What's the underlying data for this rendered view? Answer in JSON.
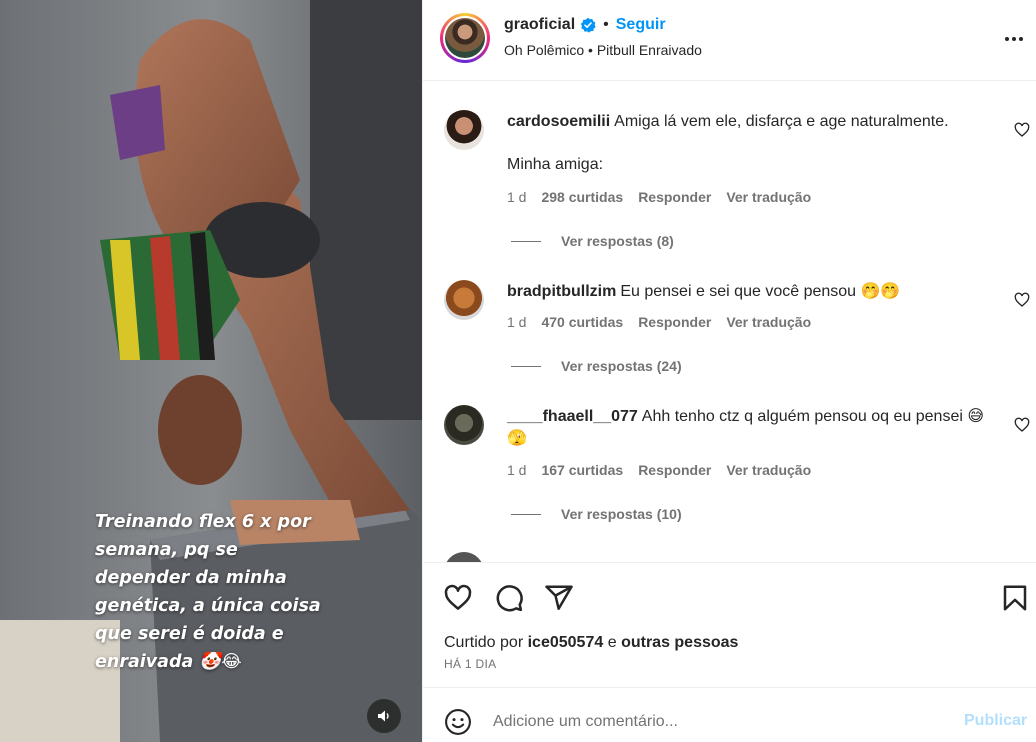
{
  "media": {
    "caption_lines": [
      "Treinando flex 6 x por",
      "semana, pq se",
      "depender da minha",
      "genética, a única coisa",
      "que serei é doida e",
      "enraivada 🤡😂"
    ],
    "sound_icon": "speaker-icon"
  },
  "header": {
    "username": "graoficial",
    "verified_icon": "verified-badge-icon",
    "separator": "•",
    "follow_label": "Seguir",
    "audio_text": "Oh Polêmico • Pitbull Enraivado",
    "more_icon": "more-options-icon"
  },
  "comments": [
    {
      "username": "cardosoemilii",
      "text": "Amiga lá vem ele, disfarça e age naturalmente.",
      "extra": "Minha amiga:",
      "time": "1 d",
      "likes": "298 curtidas",
      "reply": "Responder",
      "translate": "Ver tradução",
      "view_replies": "Ver respostas (8)"
    },
    {
      "username": "bradpitbullzim",
      "text": "Eu pensei e sei que você pensou 🤭🤭",
      "time": "1 d",
      "likes": "470 curtidas",
      "reply": "Responder",
      "translate": "Ver tradução",
      "view_replies": "Ver respostas (24)"
    },
    {
      "username": "____fhaaell__077",
      "text": "Ahh tenho ctz q alguém pensou oq eu pensei 😅🫣",
      "time": "1 d",
      "likes": "167 curtidas",
      "reply": "Responder",
      "translate": "Ver tradução",
      "view_replies": "Ver respostas (10)"
    }
  ],
  "actions": {
    "icons": [
      "heart-icon",
      "comment-icon",
      "share-icon",
      "bookmark-icon"
    ],
    "liked_prefix": "Curtido por",
    "liked_user": "ice050574",
    "liked_conj": "e",
    "liked_others": "outras pessoas",
    "time_ago": "HÁ 1 DIA"
  },
  "add_comment": {
    "placeholder": "Adicione um comentário...",
    "publish_label": "Publicar",
    "emoji_icon": "emoji-icon"
  },
  "colors": {
    "accent": "#0095f6",
    "publish_disabled": "#b2dffc",
    "muted_text": "#737373"
  }
}
